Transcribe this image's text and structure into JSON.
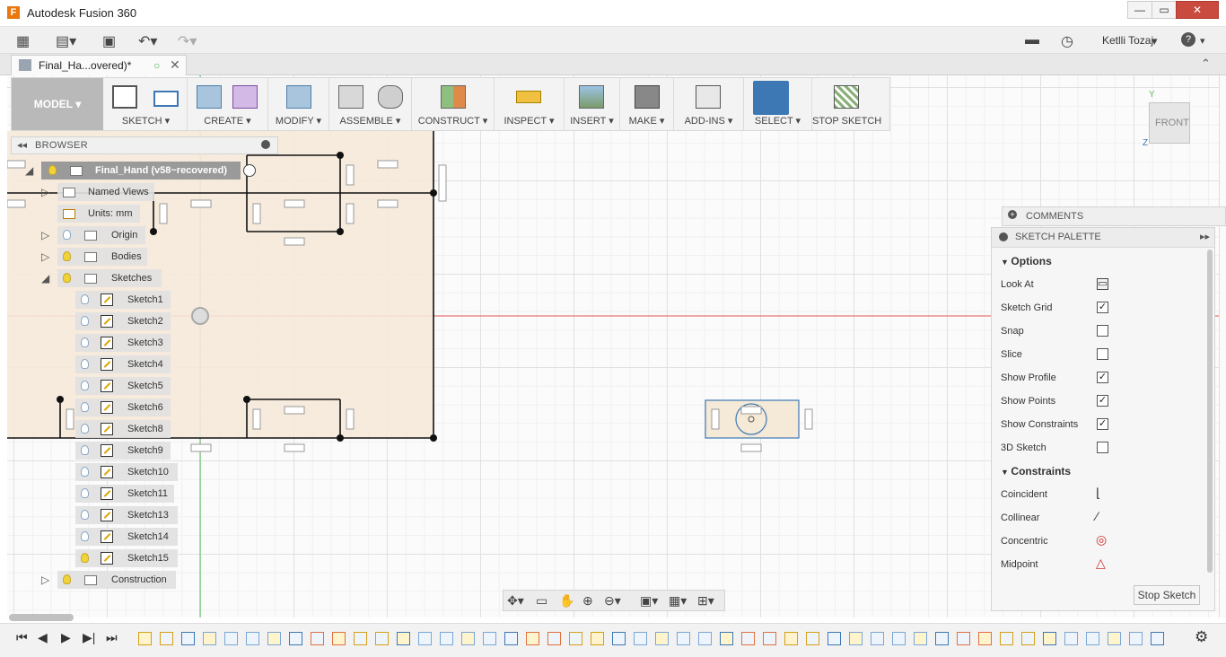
{
  "window": {
    "title": "Autodesk Fusion 360",
    "logo_letter": "F",
    "minimize": "—",
    "maximize": "▭",
    "close": "✕"
  },
  "qat": {
    "user": "Ketlli Tozaj",
    "help": "?"
  },
  "doc_tab": {
    "label": "Final_Ha...overed)*"
  },
  "ribbon": {
    "workspace": "MODEL ▾",
    "groups": [
      {
        "label": "SKETCH ▾"
      },
      {
        "label": "CREATE ▾"
      },
      {
        "label": "MODIFY ▾"
      },
      {
        "label": "ASSEMBLE ▾"
      },
      {
        "label": "CONSTRUCT ▾"
      },
      {
        "label": "INSPECT ▾"
      },
      {
        "label": "INSERT ▾"
      },
      {
        "label": "MAKE ▾"
      },
      {
        "label": "ADD-INS ▾"
      },
      {
        "label": "SELECT ▾"
      },
      {
        "label": "STOP SKETCH"
      }
    ]
  },
  "browser": {
    "title": "BROWSER",
    "root": "Final_Hand (v58~recovered)",
    "named_views": "Named Views",
    "units": "Units: mm",
    "origin": "Origin",
    "bodies": "Bodies",
    "sketches": "Sketches",
    "sketch_items": [
      "Sketch1",
      "Sketch2",
      "Sketch3",
      "Sketch4",
      "Sketch5",
      "Sketch6",
      "Sketch8",
      "Sketch9",
      "Sketch10",
      "Sketch11",
      "Sketch13",
      "Sketch14",
      "Sketch15"
    ],
    "construction": "Construction"
  },
  "comments": {
    "title": "COMMENTS"
  },
  "palette": {
    "title": "SKETCH PALETTE",
    "options_title": "Options",
    "options": [
      {
        "label": "Look At",
        "type": "icon"
      },
      {
        "label": "Sketch Grid",
        "checked": true
      },
      {
        "label": "Snap",
        "checked": false
      },
      {
        "label": "Slice",
        "checked": false
      },
      {
        "label": "Show Profile",
        "checked": true
      },
      {
        "label": "Show Points",
        "checked": true
      },
      {
        "label": "Show Constraints",
        "checked": true
      },
      {
        "label": "3D Sketch",
        "checked": false
      }
    ],
    "constraints_title": "Constraints",
    "constraints": [
      "Coincident",
      "Collinear",
      "Concentric",
      "Midpoint"
    ],
    "stop_button": "Stop Sketch"
  },
  "viewcube": {
    "face": "FRONT",
    "axis_y": "Y",
    "axis_z": "Z"
  },
  "colors": {
    "accent": "#3d78b5",
    "sketch_fill": "#f5e9d8",
    "axis_red": "#e25555",
    "axis_green": "#5bbf5b"
  }
}
